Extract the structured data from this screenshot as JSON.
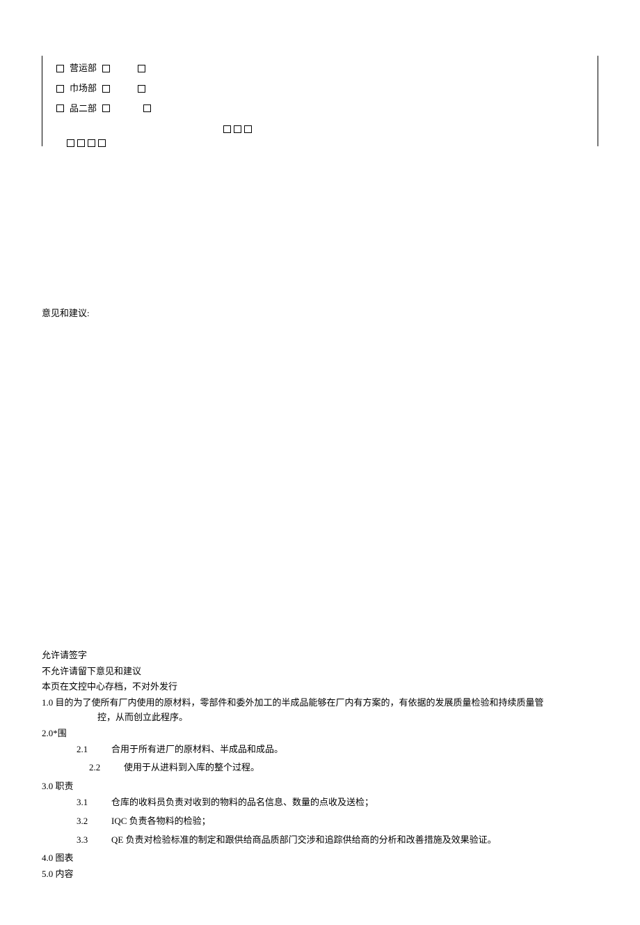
{
  "topBox": {
    "row1_label": "营运部",
    "row2_label": "巾场部",
    "row3_label": "品二部"
  },
  "feedback": {
    "heading": "意见和建议:"
  },
  "signatureLines": {
    "line1": "允许请签字",
    "line2": "不允许请留下意见和建议",
    "line3": "本页在文控中心存档，不对外发行"
  },
  "section1": {
    "heading": "1.0 目的为了使所有厂内使用的原材料，零部件和委外加工的半成品能够在厂内有方案的，有依据的发展质量检验和持续质量管",
    "cont": "控，从而创立此程序。"
  },
  "section2": {
    "heading": "2.0*围",
    "items": [
      {
        "num": "2.1",
        "text": "合用于所有进厂的原材料、半成品和成品。"
      },
      {
        "num": "2.2",
        "text": "使用于从进料到入库的整个过程。"
      }
    ]
  },
  "section3": {
    "heading": "3.0 职责",
    "items": [
      {
        "num": "3.1",
        "text": "仓库的收料员负责对收到的物料的品名信息、数量的点收及送检；"
      },
      {
        "num": "3.2",
        "text": "IQC 负责各物料的检验；"
      },
      {
        "num": "3.3",
        "text": "QE 负责对检验标准的制定和跟供给商品质部门交涉和追踪供给商的分析和改善措施及效果验证。"
      }
    ]
  },
  "section4": {
    "heading": "4.0 图表"
  },
  "section5": {
    "heading": "5.0 内容"
  }
}
